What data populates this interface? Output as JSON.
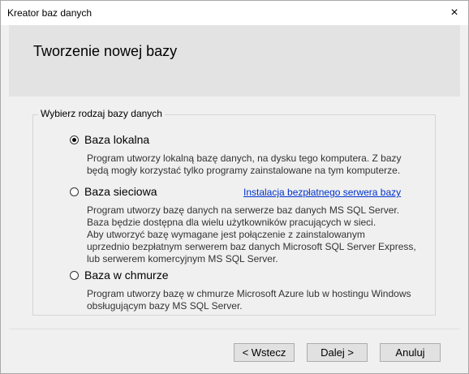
{
  "window": {
    "title": "Kreator baz danych",
    "close_glyph": "×"
  },
  "header": {
    "title": "Tworzenie nowej bazy"
  },
  "group": {
    "legend": "Wybierz rodzaj bazy danych"
  },
  "options": [
    {
      "label": "Baza lokalna",
      "checked": true,
      "description": [
        "Program utworzy lokalną bazę danych, na dysku tego komputera. Z bazy",
        "będą mogły korzystać tylko programy zainstalowane na tym komputerze."
      ]
    },
    {
      "label": "Baza sieciowa",
      "checked": false,
      "link": "Instalacja bezpłatnego serwera bazy",
      "description": [
        "Program utworzy bazę danych na serwerze baz danych MS SQL Server.",
        "Baza będzie dostępna dla wielu użytkowników pracujących w sieci.",
        "Aby utworzyć bazę wymagane jest połączenie z zainstalowanym",
        "uprzednio bezpłatnym serwerem baz danych Microsoft SQL Server Express,",
        "lub serwerem komercyjnym MS SQL Server."
      ]
    },
    {
      "label": "Baza w chmurze",
      "checked": false,
      "description": [
        "Program utworzy bazę w chmurze Microsoft Azure lub w hostingu Windows",
        "obsługującym bazy MS SQL Server."
      ]
    }
  ],
  "buttons": {
    "back": "< Wstecz",
    "next": "Dalej >",
    "cancel": "Anuluj"
  }
}
